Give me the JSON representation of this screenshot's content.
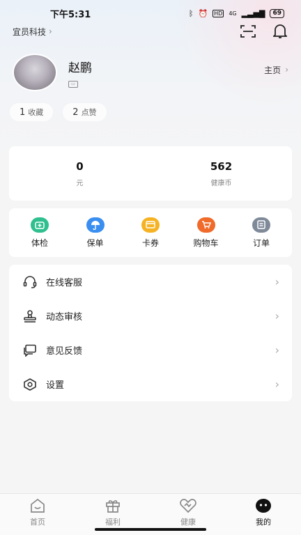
{
  "status_bar": {
    "time": "下午5:31",
    "network": "4G",
    "battery": "69"
  },
  "header": {
    "org_name": "宜员科技"
  },
  "profile": {
    "name": "赵鹏",
    "homepage_label": "主页"
  },
  "stats": [
    {
      "count": "1",
      "label": "收藏"
    },
    {
      "count": "2",
      "label": "点赞"
    }
  ],
  "balance": [
    {
      "value": "0",
      "label": "元"
    },
    {
      "value": "562",
      "label": "健康币"
    }
  ],
  "shortcuts": [
    {
      "label": "体检",
      "icon": "medical-kit-icon",
      "color": "#2fbf8f"
    },
    {
      "label": "保单",
      "icon": "umbrella-icon",
      "color": "#3a8ef0"
    },
    {
      "label": "卡券",
      "icon": "card-icon",
      "color": "#f5b324"
    },
    {
      "label": "购物车",
      "icon": "cart-icon",
      "color": "#f06a2a"
    },
    {
      "label": "订单",
      "icon": "order-icon",
      "color": "#7f8a99"
    }
  ],
  "menu": [
    {
      "label": "在线客服",
      "icon": "headset-icon"
    },
    {
      "label": "动态审核",
      "icon": "stamp-icon"
    },
    {
      "label": "意见反馈",
      "icon": "feedback-icon"
    },
    {
      "label": "设置",
      "icon": "settings-icon"
    }
  ],
  "tabs": [
    {
      "label": "首页",
      "icon": "home-icon"
    },
    {
      "label": "福利",
      "icon": "gift-icon"
    },
    {
      "label": "健康",
      "icon": "heart-icon"
    },
    {
      "label": "我的",
      "icon": "profile-face-icon",
      "active": true
    }
  ]
}
